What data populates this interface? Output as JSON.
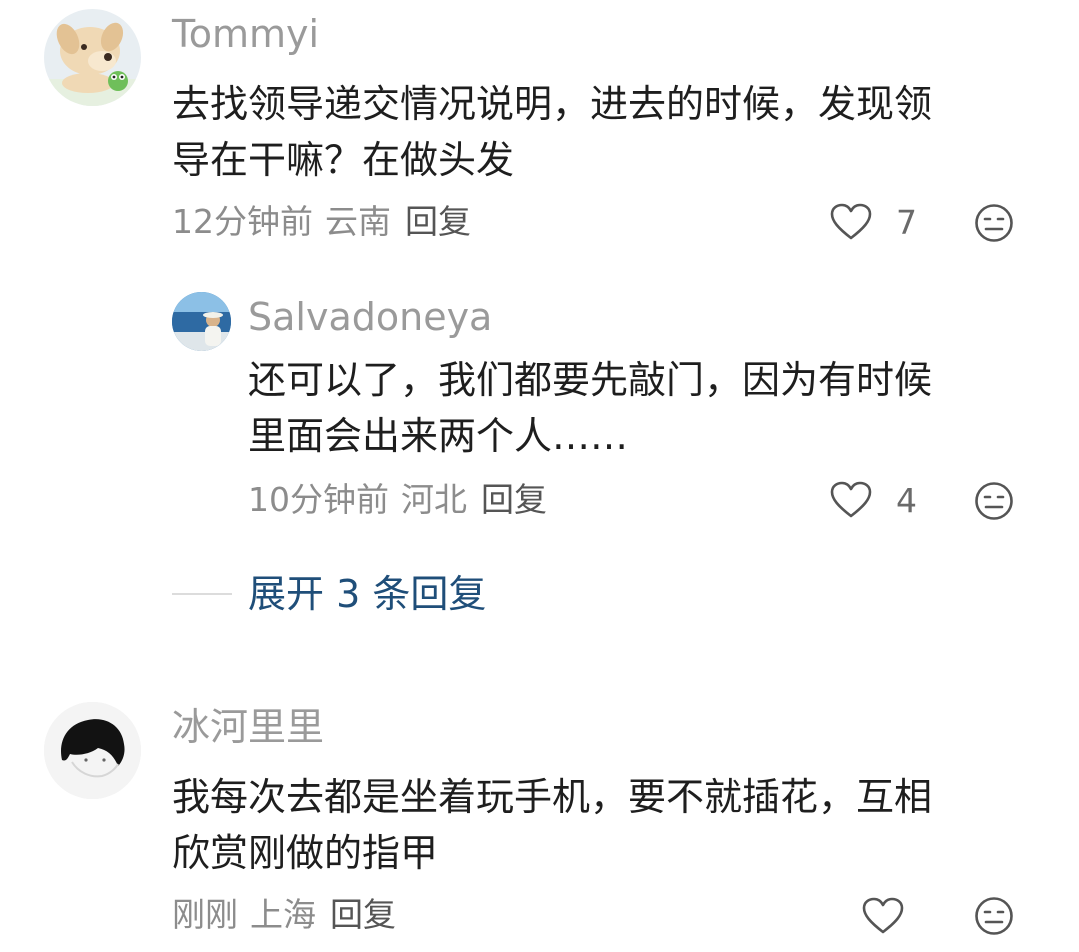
{
  "comments": [
    {
      "username": "Tommyi",
      "text_line1": "去找领导递交情况说明，进去的时候，发现领",
      "text_line2": "导在干嘛？在做头发",
      "time": "12分钟前",
      "location": "云南",
      "reply_label": "回复",
      "likes": "7",
      "avatar_icon": "puppy-with-frog-avatar",
      "replies": [
        {
          "username": "Salvadoneya",
          "text_line1": "还可以了，我们都要先敲门，因为有时候",
          "text_line2": "里面会出来两个人……",
          "time": "10分钟前",
          "location": "河北",
          "reply_label": "回复",
          "likes": "4",
          "avatar_icon": "sea-photo-avatar"
        }
      ],
      "expand_label": "展开 3 条回复"
    },
    {
      "username": "冰河里里",
      "text_line1": "我每次去都是坐着玩手机，要不就插花，互相",
      "text_line2": "欣赏刚做的指甲",
      "time": "刚刚",
      "location": "上海",
      "reply_label": "回复",
      "likes": "",
      "avatar_icon": "black-hair-sketch-avatar"
    }
  ],
  "icons": {
    "like": "heart-outline-icon",
    "dislike": "meh-face-icon"
  },
  "colors": {
    "username": "#9a9a9a",
    "text": "#1e1e1e",
    "meta": "#8c8c8c",
    "expand_link": "#1f4e79"
  }
}
